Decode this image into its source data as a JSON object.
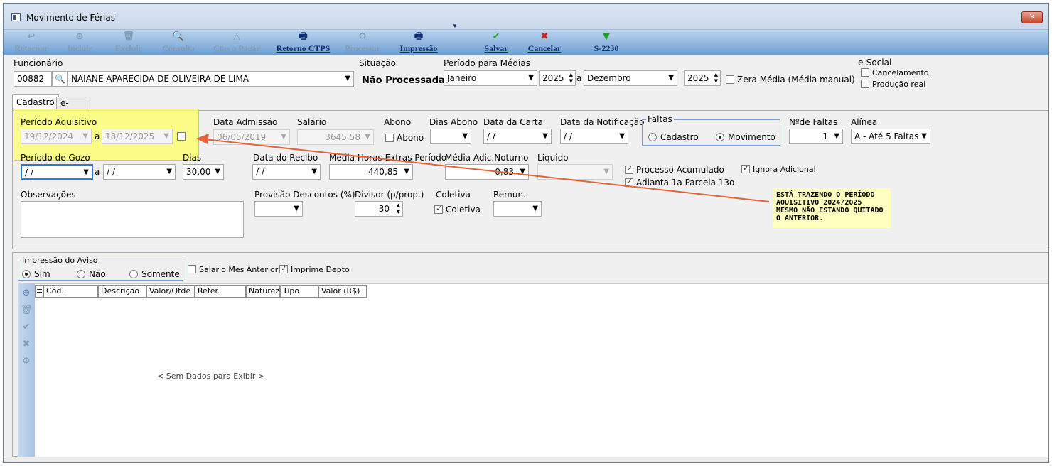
{
  "window": {
    "title": "Movimento de Férias",
    "close_label": "✕"
  },
  "toolbar": {
    "items": [
      {
        "label": "Retornar",
        "icon": "↩"
      },
      {
        "label": "Incluir",
        "icon": "⊕"
      },
      {
        "label": "Excluir",
        "icon": "🗑"
      },
      {
        "label": "Consulta",
        "icon": "🔍"
      },
      {
        "label": "Ctas a Pagar",
        "icon": "△"
      },
      {
        "label": "Retorno CTPS",
        "icon": "🖶"
      },
      {
        "label": "Processar",
        "icon": "⚙"
      },
      {
        "label": "Impressão",
        "icon": "🖶",
        "dropdown": "▼"
      },
      {
        "label": "Salvar",
        "icon": "✔"
      },
      {
        "label": "Cancelar",
        "icon": "✖"
      },
      {
        "label": "S-2230",
        "icon": "▼"
      }
    ]
  },
  "header": {
    "funcionario_label": "Funcionário",
    "funcionario_code": "00882",
    "funcionario_name": "NAIANE APARECIDA DE OLIVEIRA DE LIMA",
    "situacao_label": "Situação",
    "situacao_value": "Não Processada",
    "periodo_medias_label": "Período para Médias",
    "mes_inicio": "Janeiro",
    "ano_inicio": "2025",
    "sep": "a",
    "mes_fim": "Dezembro",
    "ano_fim": "2025",
    "zera_media_label": "Zera Média (Média manual)",
    "esocial_label": "e-Social",
    "cancelamento_label": "Cancelamento",
    "producao_label": "Produção real"
  },
  "tabs": [
    {
      "label": "Cadastro"
    },
    {
      "label": "e-Social"
    }
  ],
  "cadastro": {
    "periodo_aquisitivo_label": "Período Aquisitivo",
    "pa_inicio": "19/12/2024",
    "pa_fim": "18/12/2025",
    "sep": "a",
    "data_admissao_label": "Data Admissão",
    "data_admissao": "06/05/2019",
    "salario_label": "Salário",
    "salario": "3645,58",
    "abono_label": "Abono",
    "abono_check_label": "Abono",
    "dias_abono_label": "Dias Abono",
    "data_carta_label": "Data da Carta",
    "data_carta": "/ /",
    "data_notificacao_label": "Data da Notificação",
    "data_notificacao": "/ /",
    "faltas_label": "Faltas",
    "faltas_cadastro": "Cadastro",
    "faltas_movimento": "Movimento",
    "num_faltas_label": "Nºde Faltas",
    "num_faltas": "1",
    "alinea_label": "Alínea",
    "alinea": "A - Até 5 Faltas",
    "periodo_gozo_label": "Período de Gozo",
    "pg_inicio": "/ /",
    "pg_fim": "/ /",
    "dias_label": "Dias",
    "dias": "30,00",
    "data_recibo_label": "Data do Recibo",
    "data_recibo": "/ /",
    "media_horas_label": "Média Horas Extras Período",
    "media_horas": "440,85",
    "media_adic_label": "Média Adic.Noturno",
    "media_adic": "0,83",
    "liquido_label": "Líquido",
    "processo_acumulado_label": "Processo Acumulado",
    "adianta_parcela_label": "Adianta 1a Parcela 13o",
    "ignora_adicional_label": "Ignora Adicional",
    "observacoes_label": "Observações",
    "provisao_label": "Provisão Descontos (%)",
    "divisor_label": "Divisor (p/prop.)",
    "divisor": "30",
    "coletiva_label": "Coletiva",
    "coletiva_check_label": "Coletiva",
    "remun_label": "Remun."
  },
  "annotation": {
    "text": "ESTÁ TRAZENDO O PERÍODO AQUISITIVO 2024/2025 MESMO NÃO ESTANDO QUITADO O ANTERIOR.",
    "color": "#e0643c"
  },
  "impressao": {
    "label": "Impressão do Aviso",
    "sim": "Sim",
    "nao": "Não",
    "somente": "Somente",
    "salario_mes_anterior": "Salario Mes Anterior",
    "imprime_depto": "Imprime Depto"
  },
  "grid": {
    "columns": [
      "Cód.",
      "Descrição",
      "Valor/Qtde",
      "Refer.",
      "Natureza",
      "Tipo",
      "Valor (R$)"
    ],
    "empty_text": "< Sem Dados para Exibir >"
  }
}
